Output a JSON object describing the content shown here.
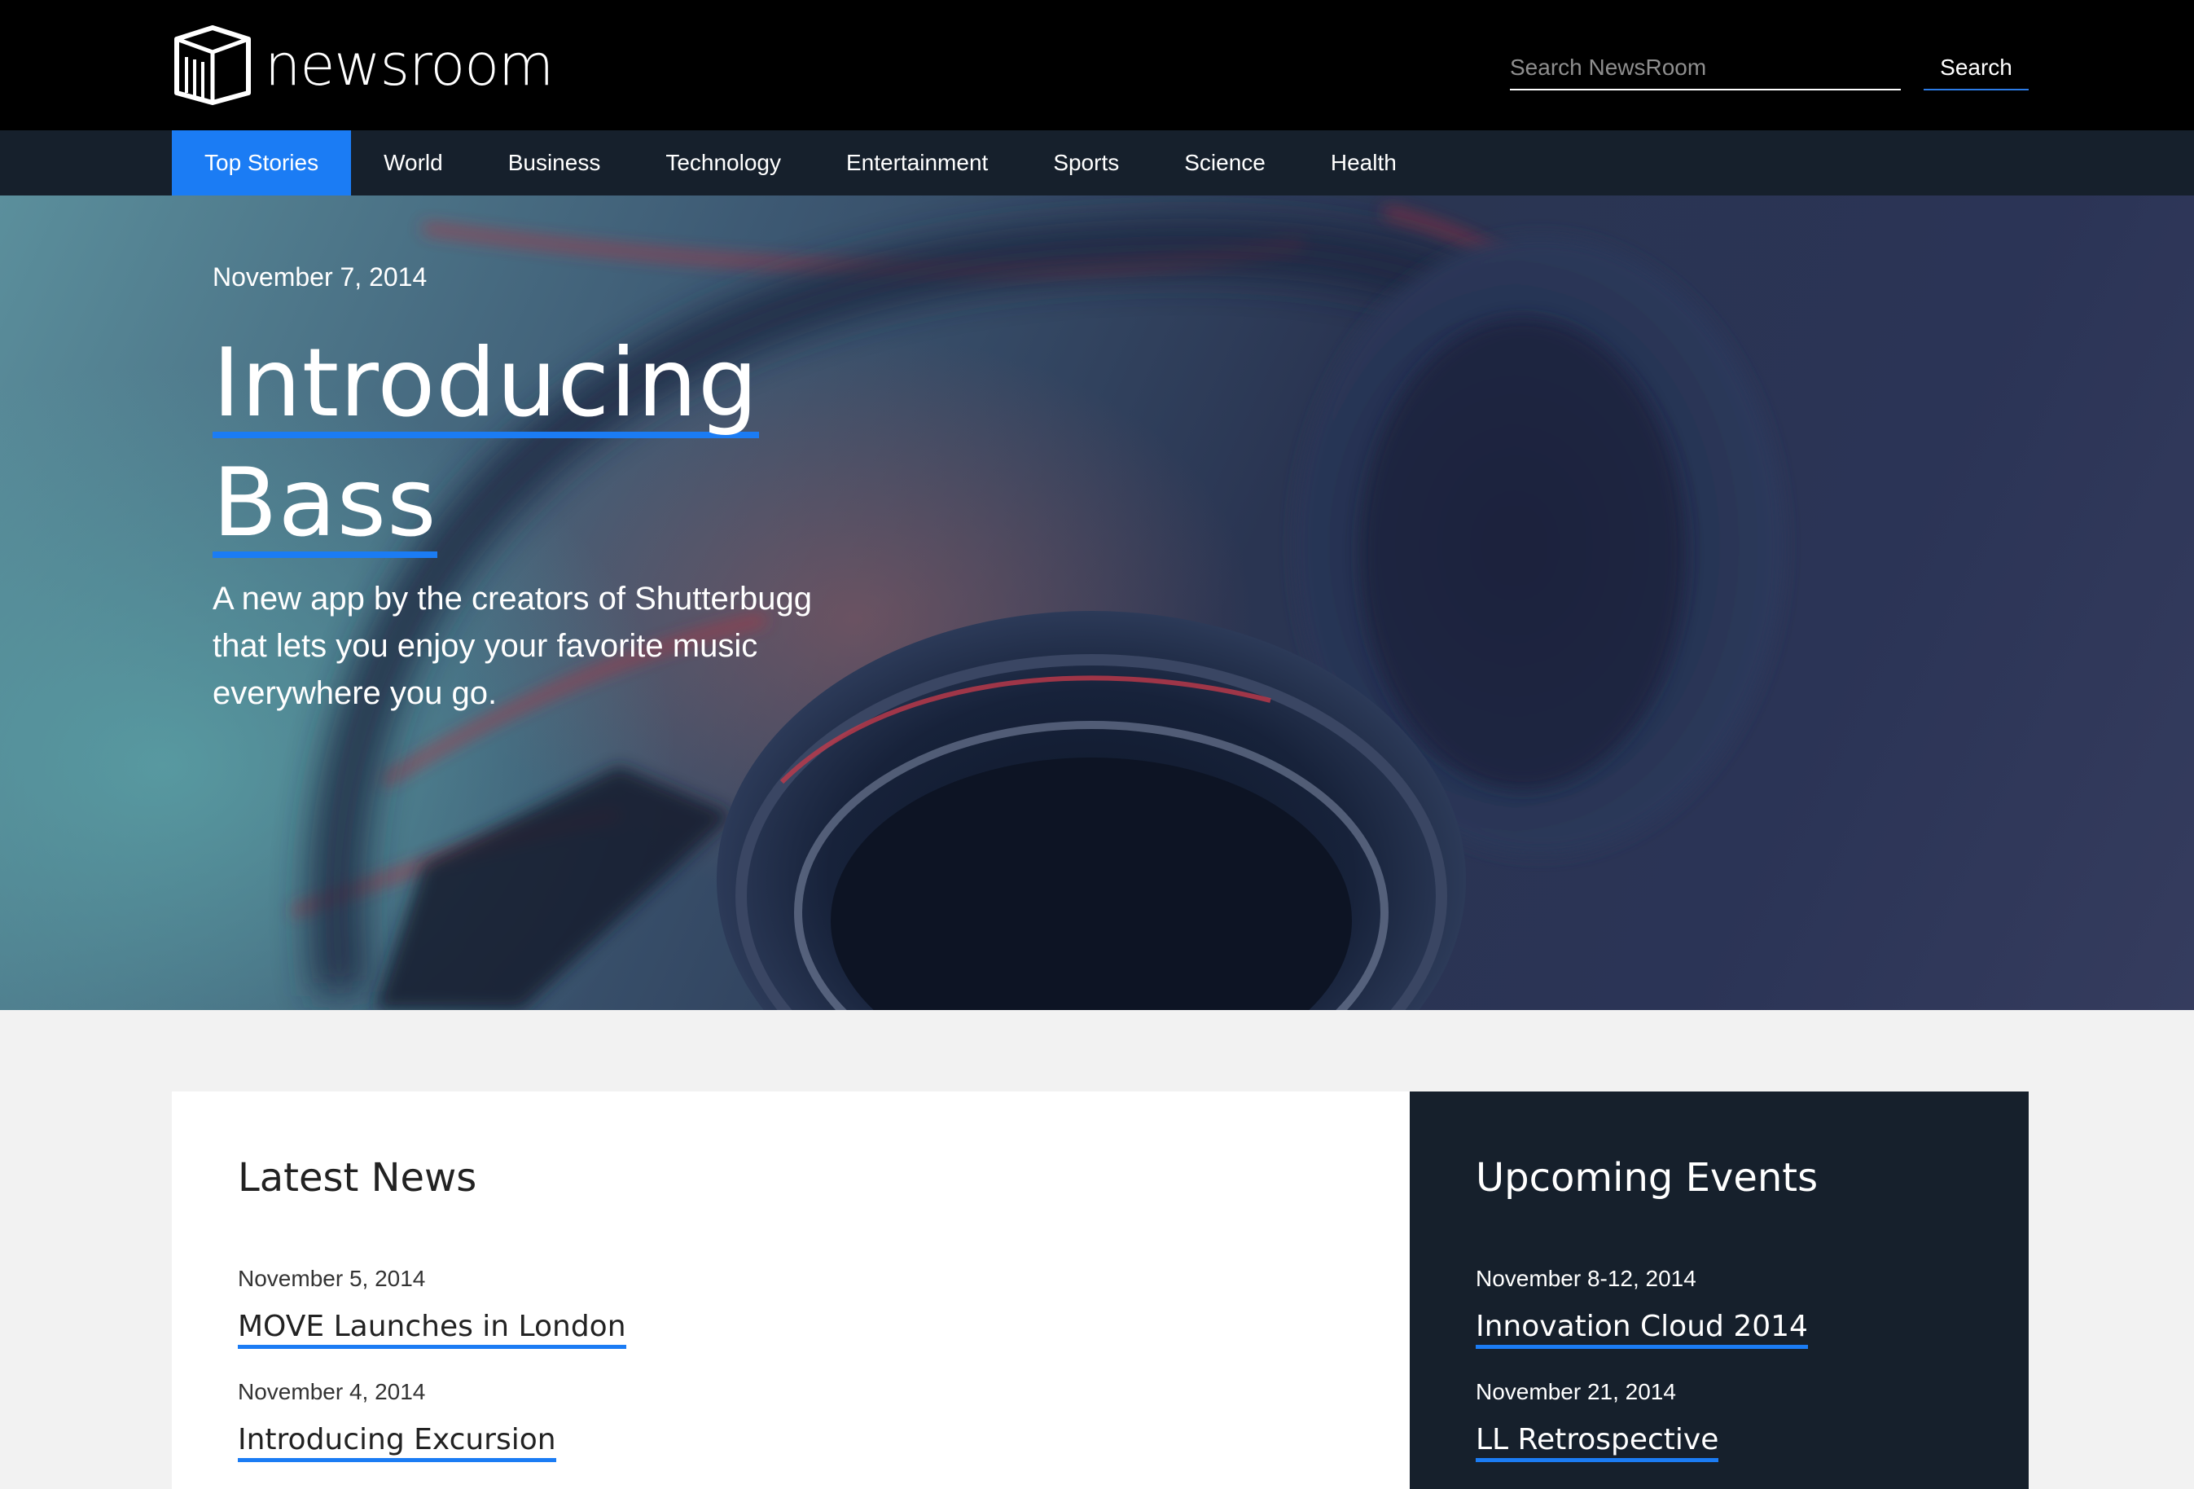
{
  "header": {
    "logo_text": "newsroom",
    "search": {
      "placeholder": "Search NewsRoom",
      "value": "",
      "button_label": "Search"
    }
  },
  "nav": {
    "items": [
      {
        "label": "Top Stories",
        "active": true
      },
      {
        "label": "World"
      },
      {
        "label": "Business"
      },
      {
        "label": "Technology"
      },
      {
        "label": "Entertainment"
      },
      {
        "label": "Sports"
      },
      {
        "label": "Science"
      },
      {
        "label": "Health"
      }
    ]
  },
  "hero": {
    "date": "November 7, 2014",
    "title_line1": "Introducing",
    "title_line2": "Bass",
    "subtitle": "A new app by the creators of Shutterbugg that lets you enjoy your favorite music everywhere you go."
  },
  "latest_news": {
    "heading": "Latest News",
    "items": [
      {
        "date": "November 5, 2014",
        "title": "MOVE Launches in London"
      },
      {
        "date": "November 4, 2014",
        "title": "Introducing Excursion"
      }
    ]
  },
  "upcoming_events": {
    "heading": "Upcoming Events",
    "items": [
      {
        "date": "November 8-12, 2014",
        "title": "Innovation Cloud 2014"
      },
      {
        "date": "November 21, 2014",
        "title": "LL Retrospective"
      }
    ]
  },
  "colors": {
    "accent": "#1b7cf4",
    "header_bg": "#000000",
    "nav_bg": "#16202c",
    "page_bg": "#f2f2f2"
  }
}
